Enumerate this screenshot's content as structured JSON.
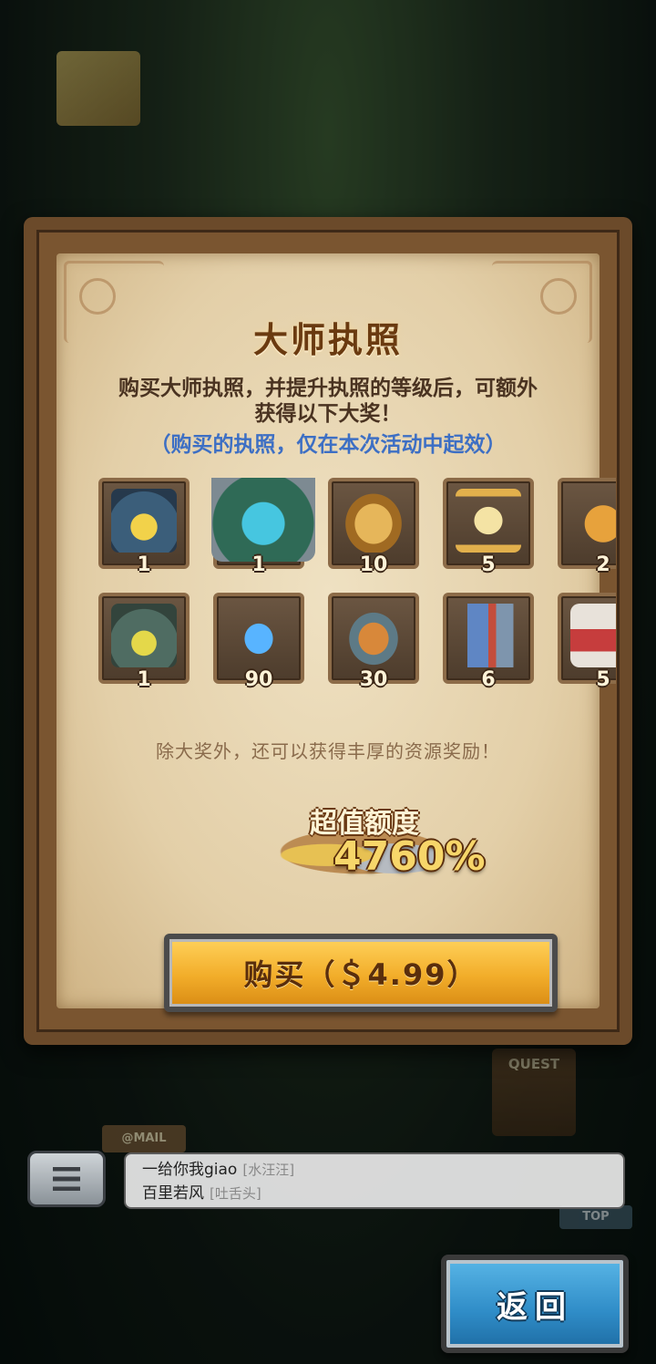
{
  "background": {
    "quest_label": "QUEST",
    "mail_label": "@MAIL",
    "top_label": "TOP"
  },
  "dialog": {
    "title": "大师执照",
    "description": "购买大师执照，并提升执照的等级后，可额外获得以下大奖！",
    "note": "（购买的执照，仅在本次活动中起效）",
    "rewards_row1": [
      {
        "icon": "hero-armored-frog",
        "count": "1"
      },
      {
        "icon": "hero-knight-slime",
        "count": "1"
      },
      {
        "icon": "golden-vase",
        "count": "10"
      },
      {
        "icon": "hourglass",
        "count": "5"
      },
      {
        "icon": "orange-bag",
        "count": "2"
      }
    ],
    "rewards_row2": [
      {
        "icon": "hero-stone-golem",
        "count": "1"
      },
      {
        "icon": "blue-crystal",
        "count": "90"
      },
      {
        "icon": "toolbox",
        "count": "30"
      },
      {
        "icon": "factory-machine",
        "count": "6"
      },
      {
        "icon": "red-can",
        "count": "5"
      }
    ],
    "sub_note": "除大奖外，还可以获得丰厚的资源奖励！",
    "value_label": "超值额度",
    "value_number": "4760%",
    "buy_button": "购买（＄4.99）"
  },
  "chat": {
    "messages": [
      {
        "text": "一给你我giao",
        "tag": "[水汪汪]"
      },
      {
        "text": "百里若风",
        "tag": "[吐舌头]"
      }
    ]
  },
  "back_button": "返回",
  "colors": {
    "title": "#6a3a10",
    "note_blue": "#3d6fc4",
    "buy_orange": "#f2ad2a",
    "back_blue": "#2f8cc7"
  }
}
